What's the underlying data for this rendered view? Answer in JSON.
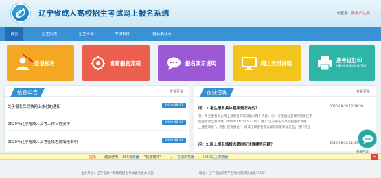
{
  "header": {
    "site_title": "辽宁省成人高校招生考试网上报名系统",
    "login_link": "未登录",
    "register_link": "新用户注册"
  },
  "nav": {
    "items": [
      {
        "label": "首页",
        "active": true
      },
      {
        "label": "招生院校",
        "active": false
      },
      {
        "label": "招生专业",
        "active": false
      },
      {
        "label": "考试科目",
        "active": false
      },
      {
        "label": "报名确认点",
        "active": false
      }
    ]
  },
  "tiles": [
    {
      "label": "登录报名",
      "color": "#f5a623",
      "icon": "user-icon"
    },
    {
      "label": "查看报名流程",
      "color": "#ec5f4f",
      "icon": "settings-icon"
    },
    {
      "label": "报名演示说明",
      "color": "#9b59d6",
      "icon": "chat-icon"
    },
    {
      "label": "网上支付说明",
      "color": "#f3c51c",
      "icon": "monitor-icon"
    },
    {
      "label": "准考证打印",
      "sub": "(请在考前规定时间打印)",
      "color": "#2db6a8",
      "icon": "printer-icon"
    }
  ],
  "notices": {
    "title": "信息公告",
    "more": "查看更多",
    "items": [
      {
        "title": "关于报名后尽快网上支付的通知",
        "date": "2020-08-27"
      },
      {
        "title": "2020年辽宁省成人高考工作日程安排",
        "date": "2020-08-26"
      },
      {
        "title": "2020年辽宁省成人高考征集志愿填报说明",
        "date": "2020-08-26"
      }
    ]
  },
  "qa": {
    "title": "在线咨询",
    "more": "查看更多",
    "items": [
      {
        "question": "问：1.考生报名具体程序是怎样的？",
        "date": "2020-08-28 12:38:29",
        "answer_lines": [
          "答：考生报名分为网上预报名和现场确认两个阶段。（1）考生通过互联网登录辽宁",
          "招生考试之窗网站（WWW.LNZSKS.COM）进入“辽宁省成人高校招生考试网",
          "上报名系统”，点击“我要报名”，阅读了解报名考试录取政策和规定后，进行考生"
        ]
      },
      {
        "question": "问：2.网上报名填报志愿时应注意哪些问题？",
        "date": "2020-08-28 12:37:39"
      }
    ]
  },
  "side_button": {
    "label": "我要咨询",
    "icon": "chat-icon"
  },
  "notice_bar": {
    "prefix": "提示：",
    "text1": "建议使用",
    "browser1": "360浏览器",
    "text2": "\"极速模式\"",
    "sep": "，",
    "browser2": "谷歌浏览器",
    "text3": "、",
    "browser3": "IE10以上浏览器"
  },
  "footer": {
    "org": "主办单位：辽宁省高中等教育招生考试委员会办公室",
    "addr": "地址：辽宁省沈阳市平区地北南新园北路101号"
  }
}
